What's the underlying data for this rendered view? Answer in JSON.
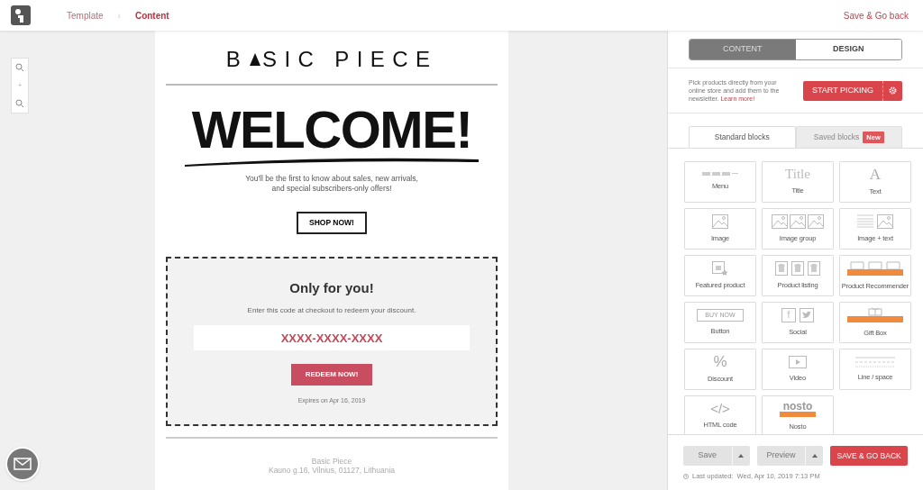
{
  "topbar": {
    "breadcrumbs": [
      {
        "label": "Template",
        "selected": false
      },
      {
        "label": "Content",
        "selected": true
      }
    ],
    "separator": "›",
    "action": "Save & Go back"
  },
  "zoom": {
    "separator": "+"
  },
  "email": {
    "logo_left": "B",
    "logo_right": "SIC PIECE",
    "headline": "WELCOME!",
    "intro": "You'll be the first to know about sales, new arrivals,\nand special subscribers-only offers!",
    "shop_button": "SHOP NOW!",
    "coupon": {
      "title": "Only for you!",
      "text": "Enter this code at checkout to redeem your discount.",
      "code": "XXXX-XXXX-XXXX",
      "button": "REDEEM NOW!",
      "expires": "Expires on Apr 16, 2019"
    },
    "footer": [
      "Basic Piece",
      "Kauno g.16, Vilnius, 01127, Lithuania"
    ]
  },
  "panel": {
    "mode_tabs": [
      {
        "label": "CONTENT",
        "selected": true
      },
      {
        "label": "DESIGN",
        "selected": false
      }
    ],
    "picker": {
      "text": "Pick products directly from your online store and add them to the newsletter.",
      "link": "Learn more!",
      "button": "START PICKING"
    },
    "block_tabs": [
      {
        "label": "Standard blocks",
        "selected": true
      },
      {
        "label": "Saved blocks",
        "selected": false,
        "badge": "New"
      }
    ],
    "blocks": [
      {
        "kind": "menu",
        "label": "Menu"
      },
      {
        "kind": "title",
        "label": "Title",
        "glyph": "Title"
      },
      {
        "kind": "text",
        "label": "Text",
        "glyph": "A"
      },
      {
        "kind": "image",
        "label": "Image"
      },
      {
        "kind": "image_group",
        "label": "Image group"
      },
      {
        "kind": "image_text",
        "label": "Image + text"
      },
      {
        "kind": "featured",
        "label": "Featured product"
      },
      {
        "kind": "listing",
        "label": "Product listing"
      },
      {
        "kind": "recommender",
        "label": "Product Recommender"
      },
      {
        "kind": "button",
        "label": "Button",
        "glyph": "BUY NOW"
      },
      {
        "kind": "social",
        "label": "Social",
        "glyph": "f"
      },
      {
        "kind": "gift",
        "label": "Gift Box"
      },
      {
        "kind": "discount",
        "label": "Discount",
        "glyph": "%"
      },
      {
        "kind": "video",
        "label": "Video"
      },
      {
        "kind": "line",
        "label": "Line / space"
      },
      {
        "kind": "html",
        "label": "HTML code",
        "glyph": "</>"
      },
      {
        "kind": "nosto",
        "label": "Nosto",
        "glyph": "nosto"
      }
    ],
    "footer": {
      "save": "Save",
      "preview": "Preview",
      "save_back": "SAVE & GO BACK",
      "updated": "Last updated:  Wed, Apr 10, 2019 7:13 PM"
    }
  }
}
